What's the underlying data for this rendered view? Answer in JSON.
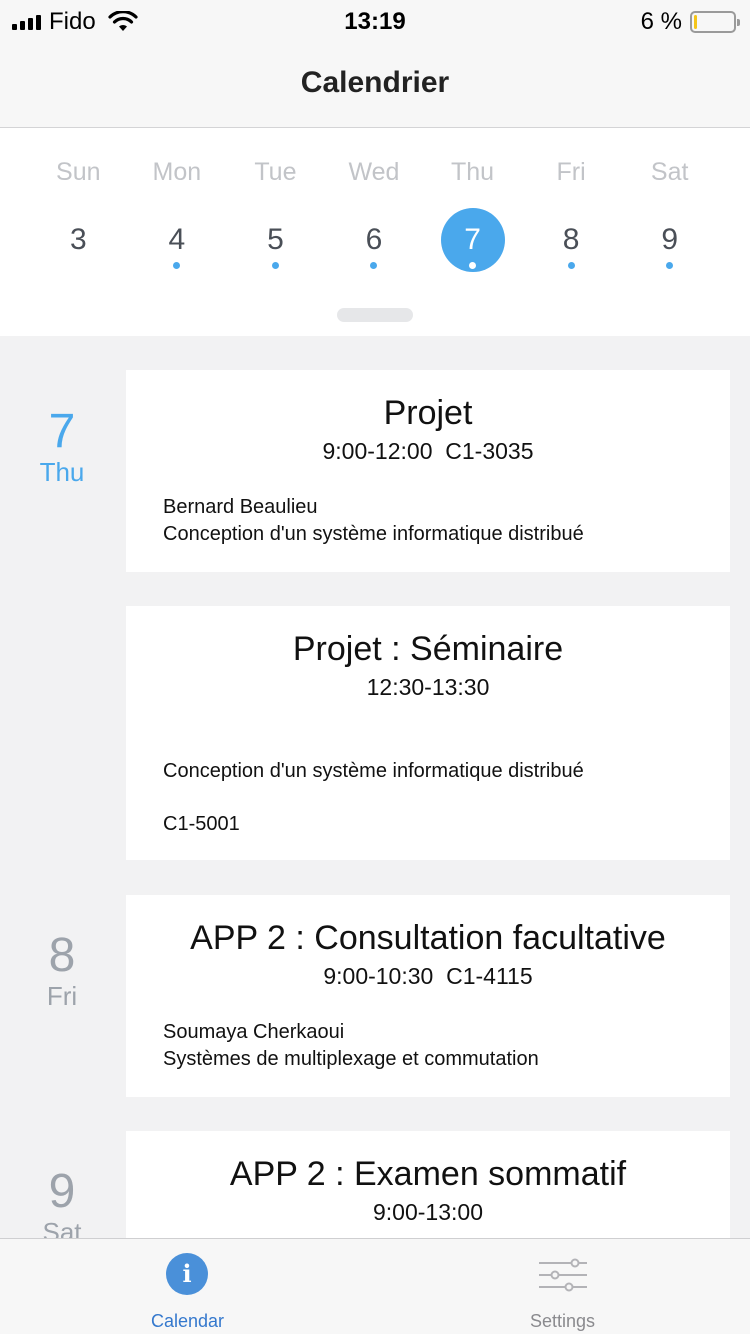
{
  "status_bar": {
    "carrier": "Fido",
    "time": "13:19",
    "battery_percent": "6 %",
    "battery_level": 0.06,
    "icons": [
      "signal-icon",
      "wifi-icon",
      "battery-icon"
    ]
  },
  "nav": {
    "title": "Calendrier"
  },
  "week": {
    "days": [
      {
        "name": "Sun",
        "date": "3",
        "has_events": false,
        "selected": false
      },
      {
        "name": "Mon",
        "date": "4",
        "has_events": true,
        "selected": false
      },
      {
        "name": "Tue",
        "date": "5",
        "has_events": true,
        "selected": false
      },
      {
        "name": "Wed",
        "date": "6",
        "has_events": true,
        "selected": false
      },
      {
        "name": "Thu",
        "date": "7",
        "has_events": true,
        "selected": true
      },
      {
        "name": "Fri",
        "date": "8",
        "has_events": true,
        "selected": false
      },
      {
        "name": "Sat",
        "date": "9",
        "has_events": true,
        "selected": false
      }
    ]
  },
  "agenda": {
    "days": [
      {
        "num": "7",
        "weekday": "Thu"
      },
      {
        "num": "8",
        "weekday": "Fri"
      },
      {
        "num": "9",
        "weekday": "Sat"
      }
    ],
    "events": [
      {
        "title": "Projet",
        "time": "9:00-12:00",
        "room": "C1-3035",
        "teacher": "Bernard Beaulieu",
        "course": "Conception d'un système informatique distribué"
      },
      {
        "title": "Projet : Séminaire",
        "time": "12:30-13:30",
        "course": "Conception d'un système informatique distribué",
        "room": "C1-5001"
      },
      {
        "title": "APP 2 : Consultation facultative",
        "time": "9:00-10:30",
        "room": "C1-4115",
        "teacher": "Soumaya Cherkaoui",
        "course": "Systèmes de multiplexage et commutation"
      },
      {
        "title": "APP 2 : Examen sommatif",
        "time": "9:00-13:00"
      }
    ]
  },
  "tabs": {
    "calendar": {
      "label": "Calendar",
      "icon": "info-icon",
      "active": true
    },
    "settings": {
      "label": "Settings",
      "icon": "sliders-icon",
      "active": false
    }
  },
  "colors": {
    "accent": "#4aa8ec",
    "tab_active": "#3478cd",
    "background": "#f2f2f3",
    "battery": "#f5c518"
  }
}
